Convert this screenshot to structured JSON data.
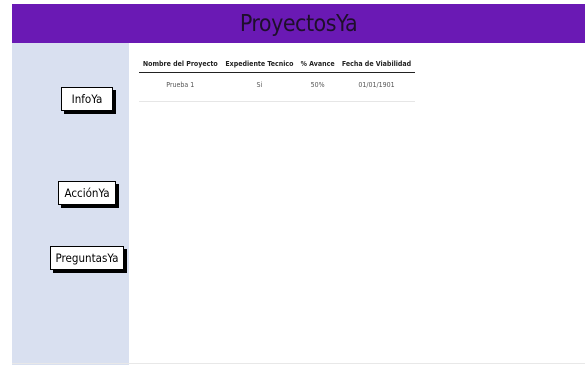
{
  "app": {
    "title": "ProyectosYa"
  },
  "sidebar": {
    "buttons": [
      {
        "label": "InfoYa"
      },
      {
        "label": "AcciónYa"
      },
      {
        "label": "PreguntasYa"
      }
    ]
  },
  "table": {
    "headers": [
      "Nombre del Proyecto",
      "Expediente Tecnico",
      "% Avance",
      "Fecha de Viabilidad"
    ],
    "rows": [
      [
        "Prueba 1",
        "Si",
        "50%",
        "01/01/1901"
      ]
    ]
  },
  "colors": {
    "header_bg": "#6a19b4",
    "sidebar_bg": "#d9e0f0",
    "title_text": "#1e0f2b"
  }
}
